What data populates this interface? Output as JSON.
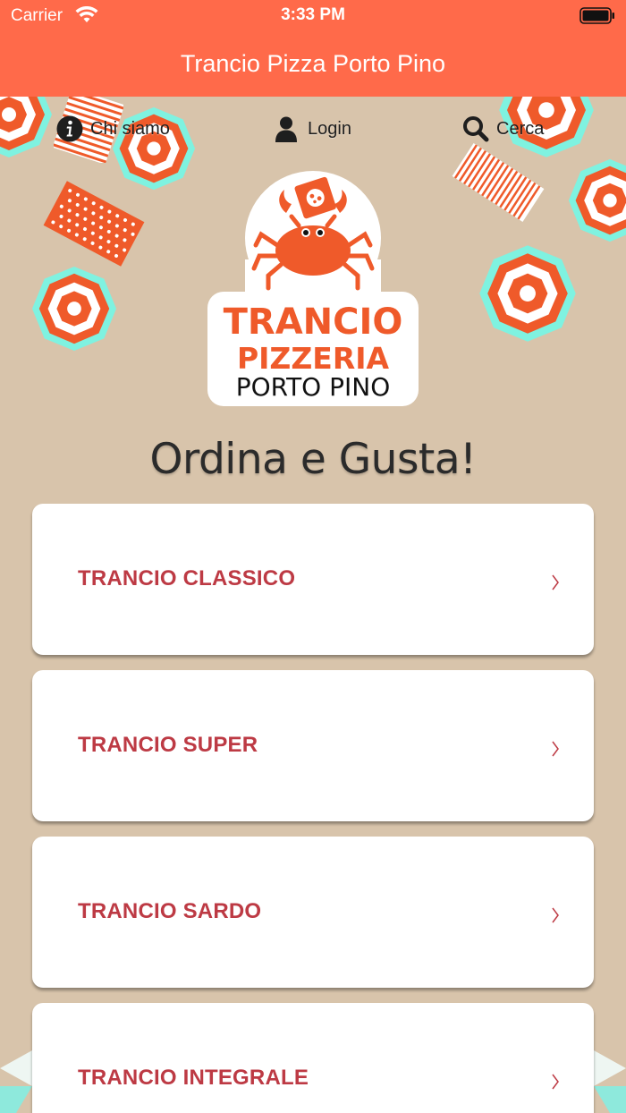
{
  "status_bar": {
    "carrier": "Carrier",
    "time": "3:33 PM"
  },
  "nav": {
    "title": "Trancio Pizza Porto Pino"
  },
  "top_links": [
    {
      "label": "Chi siamo",
      "icon": "info-icon"
    },
    {
      "label": "Login",
      "icon": "user-icon"
    },
    {
      "label": "Cerca",
      "icon": "search-icon"
    }
  ],
  "logo": {
    "line1": "TRANCIO",
    "line2": "PIZZERIA",
    "line3": "PORTO PINO"
  },
  "headline": "Ordina e Gusta!",
  "menu": [
    {
      "label": "TRANCIO CLASSICO"
    },
    {
      "label": "TRANCIO SUPER"
    },
    {
      "label": "TRANCIO SARDO"
    },
    {
      "label": "TRANCIO INTEGRALE"
    }
  ],
  "colors": {
    "brand": "#ff6a4a",
    "background": "#d8c4ab",
    "menu_text": "#bd3a44",
    "umbrella_outline": "#7ff2e0",
    "umbrella_stripe": "#ef5a2a"
  }
}
